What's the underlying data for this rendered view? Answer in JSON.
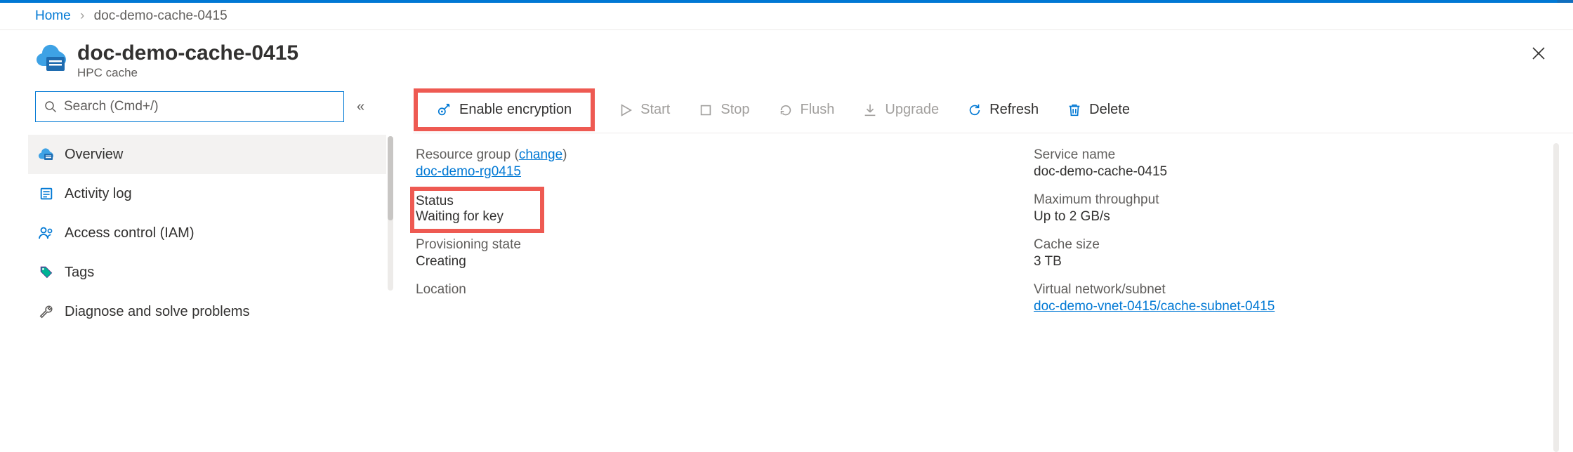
{
  "breadcrumb": {
    "home": "Home",
    "current": "doc-demo-cache-0415"
  },
  "header": {
    "title": "doc-demo-cache-0415",
    "subtitle": "HPC cache"
  },
  "search": {
    "placeholder": "Search (Cmd+/)"
  },
  "sidebar": {
    "items": [
      {
        "label": "Overview",
        "icon": "cloud-file-icon",
        "active": true
      },
      {
        "label": "Activity log",
        "icon": "log-icon",
        "active": false
      },
      {
        "label": "Access control (IAM)",
        "icon": "people-icon",
        "active": false
      },
      {
        "label": "Tags",
        "icon": "tag-icon",
        "active": false
      },
      {
        "label": "Diagnose and solve problems",
        "icon": "wrench-icon",
        "active": false
      }
    ]
  },
  "toolbar": {
    "enable_encryption": "Enable encryption",
    "start": "Start",
    "stop": "Stop",
    "flush": "Flush",
    "upgrade": "Upgrade",
    "refresh": "Refresh",
    "delete": "Delete"
  },
  "fields_left": {
    "resource_group_label": "Resource group",
    "change_label": "change",
    "resource_group_value": "doc-demo-rg0415",
    "status_label": "Status",
    "status_value": "Waiting for key",
    "provisioning_label": "Provisioning state",
    "provisioning_value": "Creating",
    "location_label": "Location"
  },
  "fields_right": {
    "service_name_label": "Service name",
    "service_name_value": "doc-demo-cache-0415",
    "max_throughput_label": "Maximum throughput",
    "max_throughput_value": "Up to 2 GB/s",
    "cache_size_label": "Cache size",
    "cache_size_value": "3 TB",
    "vnet_label": "Virtual network/subnet",
    "vnet_value": "doc-demo-vnet-0415/cache-subnet-0415"
  }
}
